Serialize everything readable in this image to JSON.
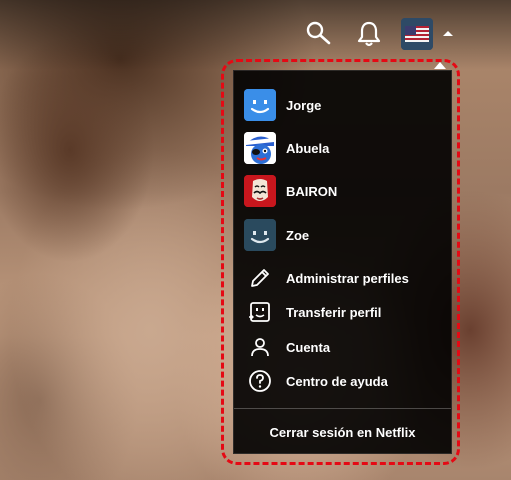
{
  "nav": {
    "search_icon": "search-icon",
    "notifications_icon": "bell-icon",
    "avatar_flag": "us-flag-avatar",
    "caret_icon": "caret-up-icon"
  },
  "menu": {
    "profiles": [
      {
        "name": "Jorge",
        "avatar": "blue-smile",
        "color": "#3a8ee8"
      },
      {
        "name": "Abuela",
        "avatar": "blue-sailor",
        "color": "#2d6fd6"
      },
      {
        "name": "BAIRON",
        "avatar": "red-dali-mask",
        "color": "#c8161d"
      },
      {
        "name": "Zoe",
        "avatar": "teal-smile",
        "color": "#2a4a5e"
      }
    ],
    "actions": [
      {
        "label": "Administrar perfiles",
        "icon": "pencil-icon"
      },
      {
        "label": "Transferir perfil",
        "icon": "transfer-profile-icon"
      },
      {
        "label": "Cuenta",
        "icon": "user-icon"
      },
      {
        "label": "Centro de ayuda",
        "icon": "help-circle-icon"
      }
    ],
    "signout_label": "Cerrar sesión en Netflix"
  },
  "colors": {
    "highlight": "#e50914",
    "menu_bg": "#000000"
  }
}
